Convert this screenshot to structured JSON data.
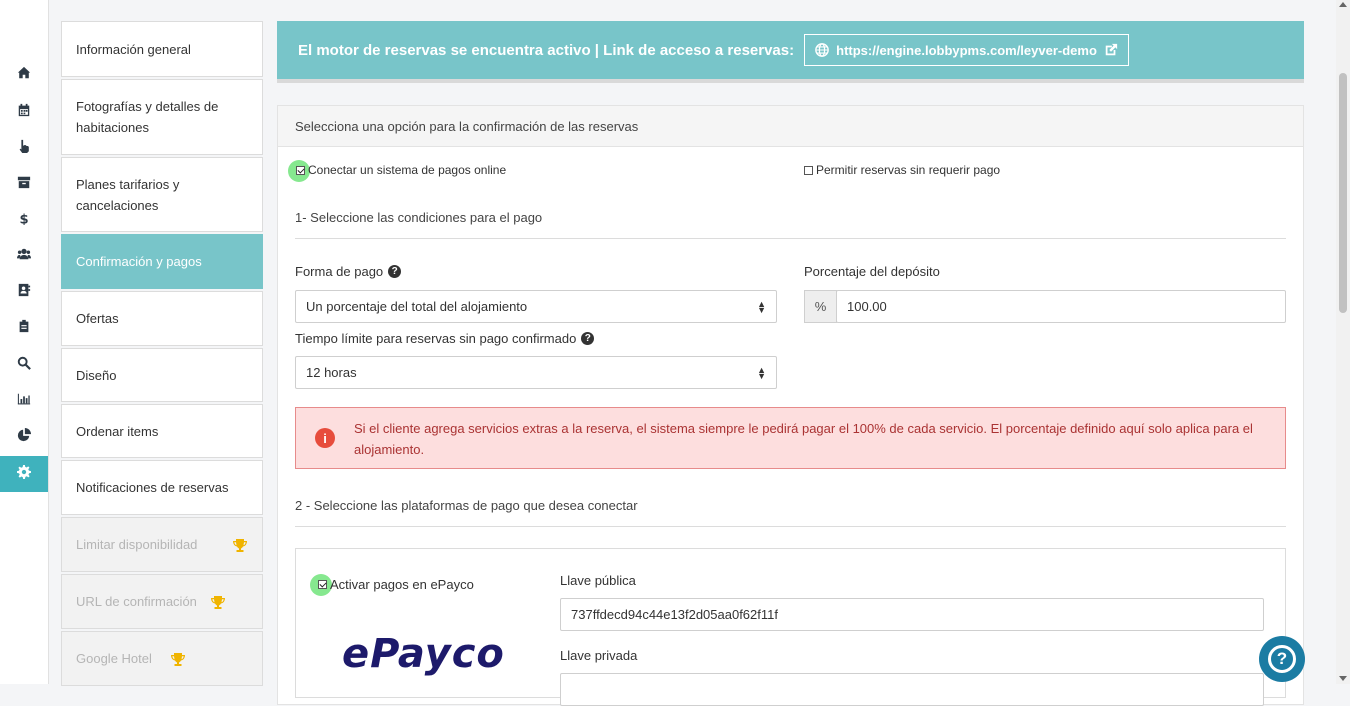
{
  "rail": {
    "items": [
      {
        "icon": "home-icon"
      },
      {
        "icon": "calendar-icon"
      },
      {
        "icon": "pointer-hand-icon"
      },
      {
        "icon": "archive-icon"
      },
      {
        "icon": "dollar-icon"
      },
      {
        "icon": "users-icon"
      },
      {
        "icon": "contact-book-icon"
      },
      {
        "icon": "clipboard-icon"
      },
      {
        "icon": "search-icon"
      },
      {
        "icon": "bar-chart-icon"
      },
      {
        "icon": "pie-chart-icon"
      },
      {
        "icon": "gear-icon",
        "active": true
      }
    ]
  },
  "submenu": {
    "items": [
      {
        "label": "Información general"
      },
      {
        "label": "Fotografías y detalles de habitaciones"
      },
      {
        "label": "Planes tarifarios y cancelaciones"
      },
      {
        "label": "Confirmación y pagos",
        "active": true
      },
      {
        "label": "Ofertas"
      },
      {
        "label": "Diseño"
      },
      {
        "label": "Ordenar items"
      },
      {
        "label": "Notificaciones de reservas"
      },
      {
        "label": "Limitar disponibilidad",
        "locked": true
      },
      {
        "label": "URL de confirmación",
        "locked": true
      },
      {
        "label": "Google Hotel",
        "locked": true
      }
    ]
  },
  "banner": {
    "text": "El motor de reservas se encuentra activo | Link de acceso a reservas:",
    "link": "https://engine.lobbypms.com/leyver-demo"
  },
  "panel": {
    "header": "Selecciona una opción para la confirmación de las reservas",
    "option_online": "Conectar un sistema de pagos online",
    "option_nopay": "Permitir reservas sin requerir pago",
    "section1": "1- Seleccione las condiciones para el pago",
    "payment_form_label": "Forma de pago",
    "payment_form_value": "Un porcentaje del total del alojamiento",
    "deposit_label": "Porcentaje del depósito",
    "deposit_addon": "%",
    "deposit_value": "100.00",
    "time_limit_label": "Tiempo límite para reservas sin pago confirmado",
    "time_limit_value": "12 horas",
    "alert": "Si el cliente agrega servicios extras a la reserva, el sistema siempre le pedirá pagar el 100% de cada servicio. El porcentaje definido aquí solo aplica para el alojamiento.",
    "section2": "2 - Seleccione las plataformas de pago que desea conectar",
    "epayco_activate": "Activar pagos en ePayco",
    "epayco_logo": "ePayco",
    "public_key_label": "Llave pública",
    "public_key_value": "737ffdecd94c44e13f2d05aa0f62f11f",
    "private_key_label": "Llave privada"
  },
  "help": {
    "symbol": "?"
  }
}
